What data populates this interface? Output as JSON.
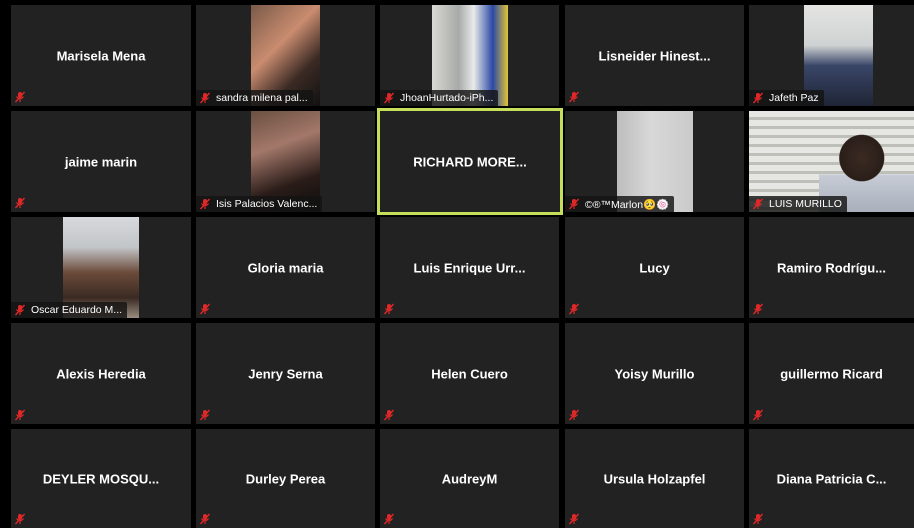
{
  "colors": {
    "tile_bg": "#222222",
    "active_border": "#c6df5a",
    "muted_mic": "#e02828"
  },
  "icons": {
    "mic": "muted-mic-icon"
  },
  "participants": [
    {
      "name": "Marisela Mena"
    },
    {
      "name": "sandra milena pal..."
    },
    {
      "name": "JhoanHurtado-iPh..."
    },
    {
      "name": "Lisneider  Hinest..."
    },
    {
      "name": "Jafeth Paz"
    },
    {
      "name": "jaime marin"
    },
    {
      "name": "Isis Palacios Valenc..."
    },
    {
      "name": "RICHARD  MORE..."
    },
    {
      "name": "©®™Marlon🥺🍥"
    },
    {
      "name": "LUIS MURILLO"
    },
    {
      "name": "Oscar Eduardo M..."
    },
    {
      "name": "Gloria maria"
    },
    {
      "name": "Luis  Enrique  Urr..."
    },
    {
      "name": "Lucy"
    },
    {
      "name": "Ramiro  Rodrígu..."
    },
    {
      "name": "Alexis Heredia"
    },
    {
      "name": "Jenry Serna"
    },
    {
      "name": "Helen Cuero"
    },
    {
      "name": "Yoisy Murillo"
    },
    {
      "name": "guillermo Ricard"
    },
    {
      "name": "DEYLER  MOSQU..."
    },
    {
      "name": "Durley Perea"
    },
    {
      "name": "AudreyM"
    },
    {
      "name": "Ursula Holzapfel"
    },
    {
      "name": "Diana  Patricia  C..."
    }
  ]
}
